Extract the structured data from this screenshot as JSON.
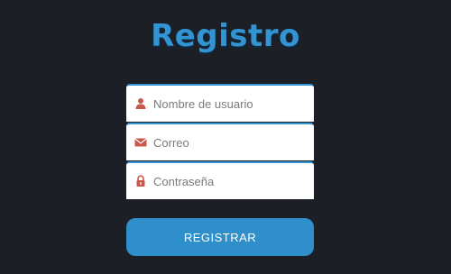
{
  "page": {
    "title": "Registro"
  },
  "form": {
    "fields": [
      {
        "placeholder": "Nombre de usuario",
        "icon": "user-icon"
      },
      {
        "placeholder": "Correo",
        "icon": "envelope-icon"
      },
      {
        "placeholder": "Contraseña",
        "icon": "lock-icon"
      }
    ],
    "submit_label": "REGISTRAR"
  },
  "colors": {
    "background": "#1d1f27",
    "accent": "#3294d3",
    "icon": "#c9574b"
  }
}
